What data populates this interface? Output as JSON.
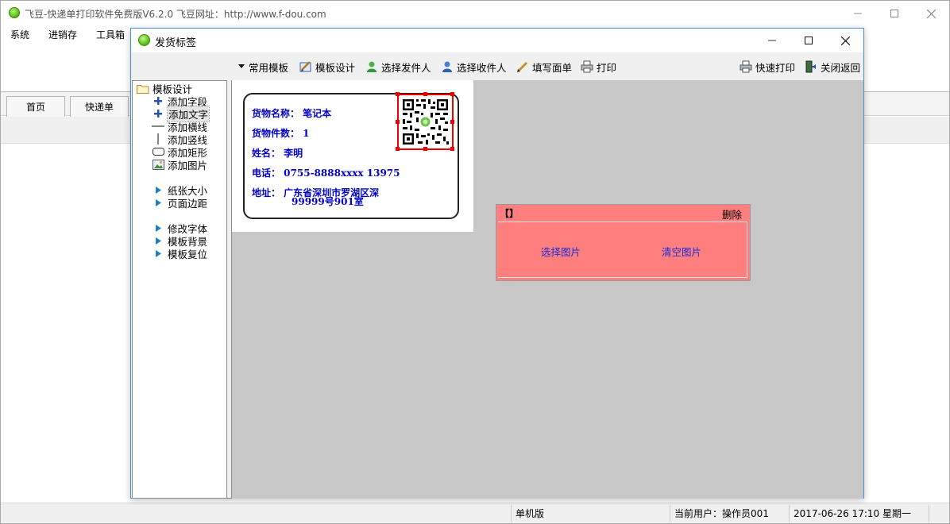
{
  "main_window": {
    "title": "飞豆-快递单打印软件免费版V6.2.0   飞豆网址：http://www.f-dou.com",
    "menu": [
      "系统",
      "进销存",
      "工具箱"
    ],
    "tabs": [
      "首页",
      "快递单"
    ]
  },
  "dialog": {
    "title": "发货标签",
    "toolbar": {
      "common_templates": "常用模板",
      "template_design": "模板设计",
      "select_sender": "选择发件人",
      "select_receiver": "选择收件人",
      "fill_form": "填写面单",
      "print": "打印",
      "quick_print": "快速打印",
      "close_return": "关闭返回"
    },
    "tree": {
      "root": "模板设计",
      "add_field": "添加字段",
      "add_text": "添加文字",
      "add_hline": "添加横线",
      "add_vline": "添加竖线",
      "add_rect": "添加矩形",
      "add_image": "添加图片",
      "paper_size": "纸张大小",
      "page_margin": "页面边距",
      "change_font": "修改字体",
      "template_bg": "模板背景",
      "template_reset": "模板复位"
    },
    "label": {
      "goods_name": "货物名称：  笔记本",
      "goods_count": "货物件数：  1",
      "name": "姓名：    李明",
      "phone": "电话：    0755-8888xxxx 13975",
      "address_line1": "地址：    广东省深圳市罗湖区深",
      "address_line2": "99999号901室"
    },
    "popup": {
      "tag": "【】",
      "delete": "删除",
      "select_image": "选择图片",
      "clear_image": "清空图片"
    }
  },
  "statusbar": {
    "mode": "单机版",
    "user": "当前用户：操作员001",
    "datetime": "2017-06-26 17:10 星期一"
  },
  "colors": {
    "label_text": "#0000c8",
    "popup_bg": "#ff7f7f",
    "popup_link": "#1c2bd6",
    "selection": "#e00000",
    "canvas_bg": "#c7c7c7"
  }
}
